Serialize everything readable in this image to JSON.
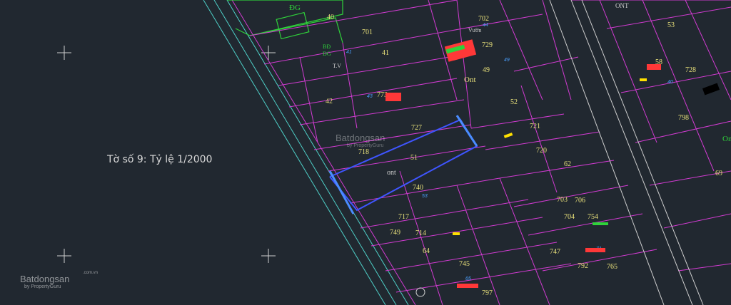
{
  "sheet_title": "Tờ số 9: Tỷ lệ 1/2000",
  "watermark": {
    "brand": "Batdongsan",
    "tagline": "by PropertyGuru",
    "domain_suffix": ".com.vn"
  },
  "zone_labels": {
    "dg": "ĐG",
    "bd": "BĐ",
    "dg2": "ĐG",
    "ont_large": "Ont",
    "ont_top": "ONT",
    "ont_sub": "ont",
    "ont_right": "Ont",
    "tv": "T.V",
    "vuon": "Vườn"
  },
  "parcels": [
    "40",
    "701",
    "41",
    "702",
    "729",
    "49",
    "53",
    "42",
    "773",
    "Ont",
    "52",
    "58",
    "728",
    "727",
    "721",
    "718",
    "51",
    "720",
    "62",
    "740",
    "706",
    "69",
    "717",
    "714",
    "704",
    "754",
    "749",
    "64",
    "747",
    "792",
    "765",
    "745",
    "797",
    "798",
    "761",
    "703",
    "750"
  ],
  "colors": {
    "background": "#212830",
    "parcel_line": "#d23bd2",
    "boundary_cyan": "#4fd0c8",
    "label_yellow": "#e8e07a",
    "area_red": "#ff3838",
    "area_blue": "#4aa0ff",
    "road_white": "#cfcfcf",
    "highlight_blue": "#3f55ff",
    "zone_green": "#2fd23a"
  }
}
